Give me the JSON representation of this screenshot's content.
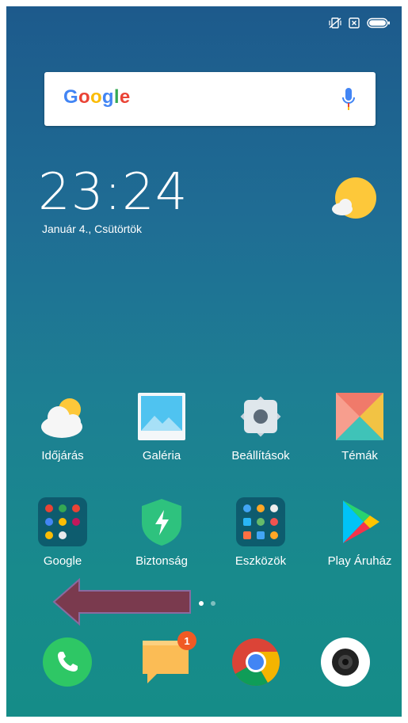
{
  "status_bar": {
    "icons": [
      "vibrate-off-icon",
      "sim-card-x-icon",
      "battery-full-icon"
    ]
  },
  "search": {
    "logo_text": "Google",
    "logo_colors": [
      "#4285F4",
      "#EA4335",
      "#FBBC05",
      "#4285F4",
      "#34A853",
      "#EA4335"
    ],
    "mic_icon": "microphone-icon"
  },
  "clock": {
    "time": "23:24",
    "date": "Január 4., Csütörtök",
    "weather_icon": "sun-cloud-icon"
  },
  "apps_row1": [
    {
      "label": "Időjárás",
      "icon": "weather-icon"
    },
    {
      "label": "Galéria",
      "icon": "gallery-icon"
    },
    {
      "label": "Beállítások",
      "icon": "settings-icon"
    },
    {
      "label": "Témák",
      "icon": "themes-icon"
    }
  ],
  "apps_row2": [
    {
      "label": "Google",
      "icon": "google-folder-icon"
    },
    {
      "label": "Biztonság",
      "icon": "security-icon"
    },
    {
      "label": "Eszközök",
      "icon": "tools-folder-icon"
    },
    {
      "label": "Play Áruház",
      "icon": "play-store-icon"
    }
  ],
  "page_indicator": {
    "pages": 2,
    "current": 1
  },
  "overlay": {
    "arrow_direction": "left",
    "arrow_color": "#7a3a4e"
  },
  "dock": [
    {
      "icon": "phone-icon"
    },
    {
      "icon": "messages-icon",
      "badge": "1"
    },
    {
      "icon": "chrome-icon"
    },
    {
      "icon": "camera-icon"
    }
  ]
}
